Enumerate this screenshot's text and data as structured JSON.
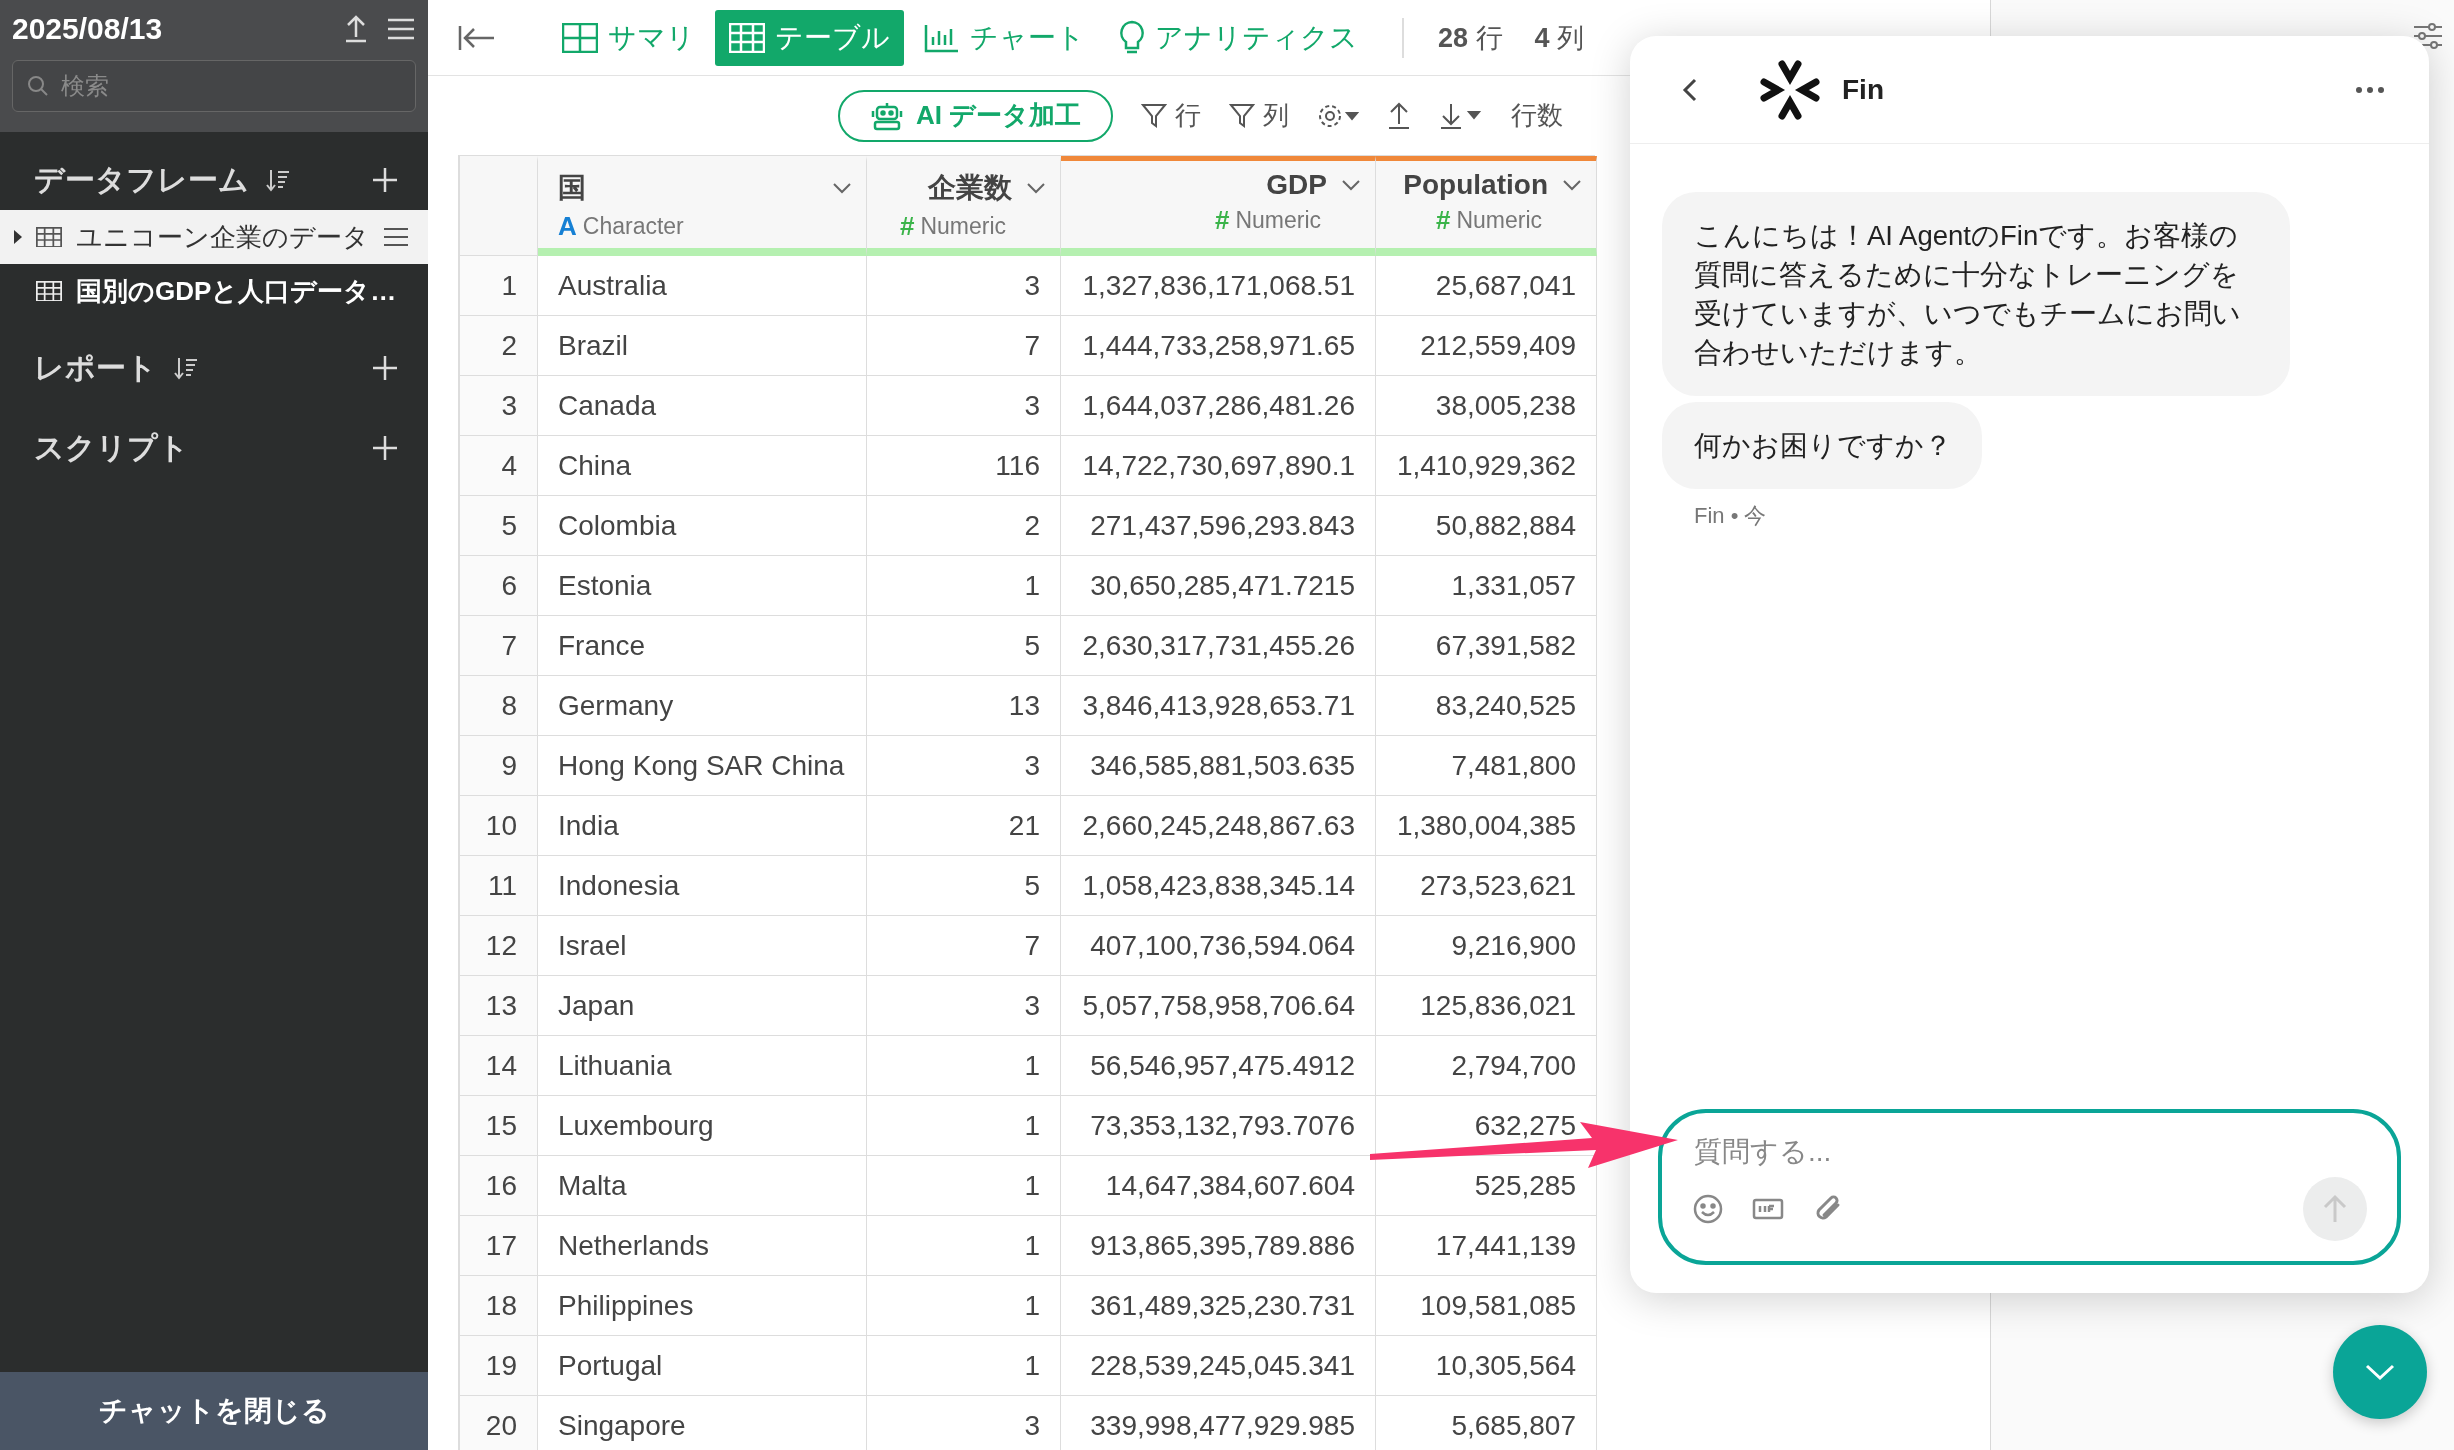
{
  "sidebar": {
    "title": "2025/08/13",
    "search": {
      "placeholder": "検索"
    },
    "sections": [
      {
        "label": "データフレーム",
        "sortable": true,
        "items": [
          {
            "label": "ユニコーン企業のデータ",
            "selected": false,
            "hovered": true
          },
          {
            "label": "国別のGDPと人口データ…",
            "selected": true,
            "hovered": false
          }
        ]
      },
      {
        "label": "レポート",
        "sortable": true
      },
      {
        "label": "スクリプト",
        "sortable": false
      }
    ],
    "close_chat_button": "チャットを閉じる"
  },
  "tabs": [
    {
      "label": "サマリ",
      "selected": false
    },
    {
      "label": "テーブル",
      "selected": true
    },
    {
      "label": "チャート",
      "selected": false
    },
    {
      "label": "アナリティクス",
      "selected": false
    }
  ],
  "counts": [
    {
      "value": "28",
      "unit": "行"
    },
    {
      "value": "4",
      "unit": "列"
    }
  ],
  "toolbar": {
    "ai_button": "AI データ加工",
    "row_filter": "行",
    "column_filter": "列",
    "row_count": "行数"
  },
  "table": {
    "columns": [
      {
        "name": "国",
        "kind": "character",
        "type_mark": "A",
        "type": "Character",
        "highlighted": false
      },
      {
        "name": "企業数",
        "kind": "numeric",
        "type_mark": "#",
        "type": "Numeric",
        "highlighted": false
      },
      {
        "name": "GDP",
        "kind": "numeric",
        "type_mark": "#",
        "type": "Numeric",
        "highlighted": true
      },
      {
        "name": "Population",
        "kind": "numeric",
        "type_mark": "#",
        "type": "Numeric",
        "highlighted": true
      }
    ],
    "rows": [
      {
        "number": "1",
        "cells": [
          "Australia",
          "3",
          "1,327,836,171,068.51",
          "25,687,041"
        ]
      },
      {
        "number": "2",
        "cells": [
          "Brazil",
          "7",
          "1,444,733,258,971.65",
          "212,559,409"
        ]
      },
      {
        "number": "3",
        "cells": [
          "Canada",
          "3",
          "1,644,037,286,481.26",
          "38,005,238"
        ]
      },
      {
        "number": "4",
        "cells": [
          "China",
          "116",
          "14,722,730,697,890.1",
          "1,410,929,362"
        ]
      },
      {
        "number": "5",
        "cells": [
          "Colombia",
          "2",
          "271,437,596,293.843",
          "50,882,884"
        ]
      },
      {
        "number": "6",
        "cells": [
          "Estonia",
          "1",
          "30,650,285,471.7215",
          "1,331,057"
        ]
      },
      {
        "number": "7",
        "cells": [
          "France",
          "5",
          "2,630,317,731,455.26",
          "67,391,582"
        ]
      },
      {
        "number": "8",
        "cells": [
          "Germany",
          "13",
          "3,846,413,928,653.71",
          "83,240,525"
        ]
      },
      {
        "number": "9",
        "cells": [
          "Hong Kong SAR China",
          "3",
          "346,585,881,503.635",
          "7,481,800"
        ]
      },
      {
        "number": "10",
        "cells": [
          "India",
          "21",
          "2,660,245,248,867.63",
          "1,380,004,385"
        ]
      },
      {
        "number": "11",
        "cells": [
          "Indonesia",
          "5",
          "1,058,423,838,345.14",
          "273,523,621"
        ]
      },
      {
        "number": "12",
        "cells": [
          "Israel",
          "7",
          "407,100,736,594.064",
          "9,216,900"
        ]
      },
      {
        "number": "13",
        "cells": [
          "Japan",
          "3",
          "5,057,758,958,706.64",
          "125,836,021"
        ]
      },
      {
        "number": "14",
        "cells": [
          "Lithuania",
          "1",
          "56,546,957,475.4912",
          "2,794,700"
        ]
      },
      {
        "number": "15",
        "cells": [
          "Luxembourg",
          "1",
          "73,353,132,793.7076",
          "632,275"
        ]
      },
      {
        "number": "16",
        "cells": [
          "Malta",
          "1",
          "14,647,384,607.604",
          "525,285"
        ]
      },
      {
        "number": "17",
        "cells": [
          "Netherlands",
          "1",
          "913,865,395,789.886",
          "17,441,139"
        ]
      },
      {
        "number": "18",
        "cells": [
          "Philippines",
          "1",
          "361,489,325,230.731",
          "109,581,085"
        ]
      },
      {
        "number": "19",
        "cells": [
          "Portugal",
          "1",
          "228,539,245,045.341",
          "10,305,564"
        ]
      },
      {
        "number": "20",
        "cells": [
          "Singapore",
          "3",
          "339,998,477,929.985",
          "5,685,807"
        ]
      }
    ]
  },
  "chat": {
    "title": "Fin",
    "messages": [
      "こんにちは！AI AgentのFinです。お客様の質問に答えるために十分なトレーニングを受けていますが、いつでもチームにお問い合わせいただけます。",
      "何かお困りですか？"
    ],
    "meta": "Fin • 今",
    "input": {
      "placeholder": "質問する..."
    },
    "send_disabled": true
  }
}
